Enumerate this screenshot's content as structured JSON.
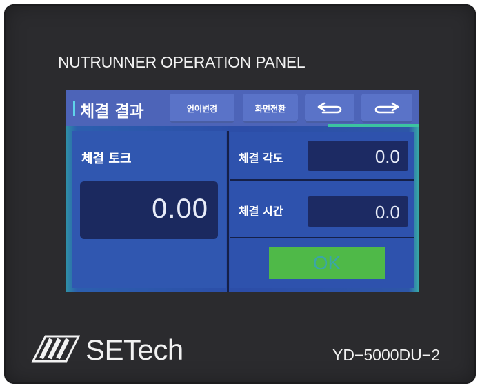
{
  "panel": {
    "title": "NUTRUNNER OPERATION PANEL",
    "brand": "SETech",
    "model": "YD−5000DU−2"
  },
  "screen": {
    "header": {
      "title": "체결 결과",
      "language_button": "언어변경",
      "screen_switch_button": "화면전환",
      "back_icon": "arrow-left-return-icon",
      "forward_icon": "arrow-right-return-icon"
    },
    "torque": {
      "label": "체결 토크",
      "value": "0.00"
    },
    "angle": {
      "label": "체결 각도",
      "value": "0.0"
    },
    "time": {
      "label": "체결 시간",
      "value": "0.0"
    },
    "ok_button": "OK"
  },
  "colors": {
    "bezel": "#2b2b2e",
    "screen_bg": "#2c4da8",
    "header_bg": "#4d64b8",
    "display_bg": "#1b295f",
    "ok_green": "#4fb948",
    "ok_text": "#3ba6a8"
  }
}
